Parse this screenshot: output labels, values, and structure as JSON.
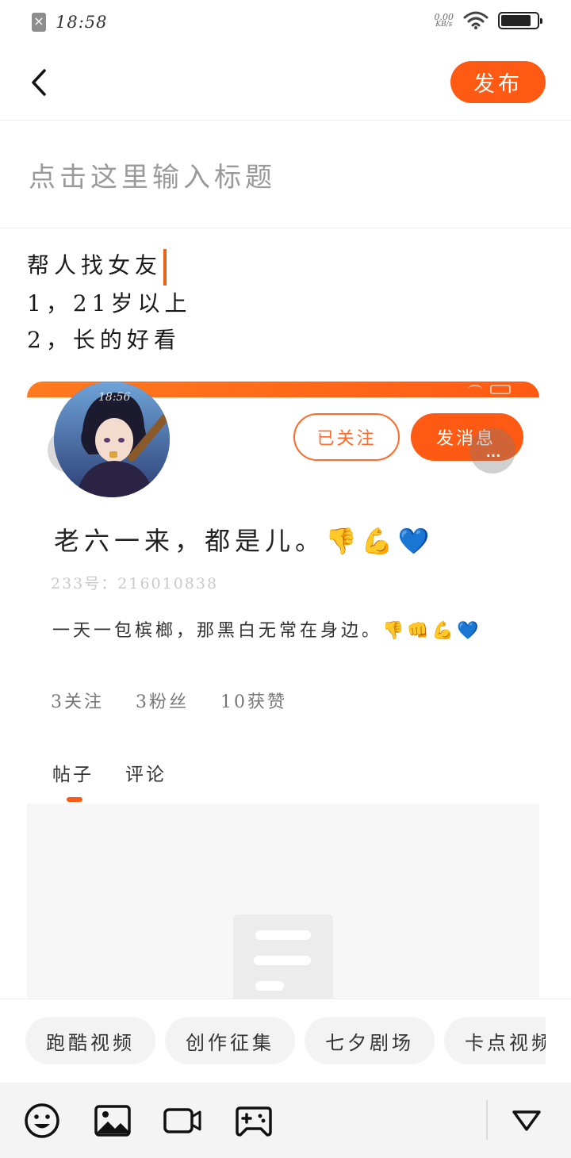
{
  "status_bar": {
    "time": "18:58",
    "net_speed_value": "0.00",
    "net_speed_unit": "KB/s",
    "battery_level": 0.85,
    "icons": [
      "sim-off-icon",
      "wifi-icon",
      "battery-icon"
    ]
  },
  "header": {
    "back_icon": "chevron-left-icon",
    "publish_label": "发布"
  },
  "editor": {
    "title_placeholder": "点击这里输入标题",
    "body_lines": [
      "帮人找女友",
      "1，21岁以上",
      "2，长的好看"
    ]
  },
  "attachment": {
    "status_time": "18:56",
    "follow_label": "已关注",
    "message_label": "发消息",
    "more_label": "...",
    "profile_name": "老六一来，都是儿。👎💪💙",
    "profile_id": "233号：216010838",
    "profile_bio": "一天一包槟榔，那黑白无常在身边。👎👊💪💙",
    "stats": [
      "3关注",
      "3粉丝",
      "10获赞"
    ],
    "tabs": [
      "帖子",
      "评论"
    ],
    "active_tab": 0
  },
  "topics": [
    "跑酷视频",
    "创作征集",
    "七夕剧场",
    "卡点视频"
  ],
  "toolbar": {
    "icons": [
      "emoji-icon",
      "image-icon",
      "video-icon",
      "game-icon",
      "collapse-icon"
    ]
  },
  "colors": {
    "accent": "#ff5a13",
    "caret": "#e8631a",
    "chip_bg": "#f3f3f3",
    "toolbar_bg": "#f4f4f4"
  }
}
